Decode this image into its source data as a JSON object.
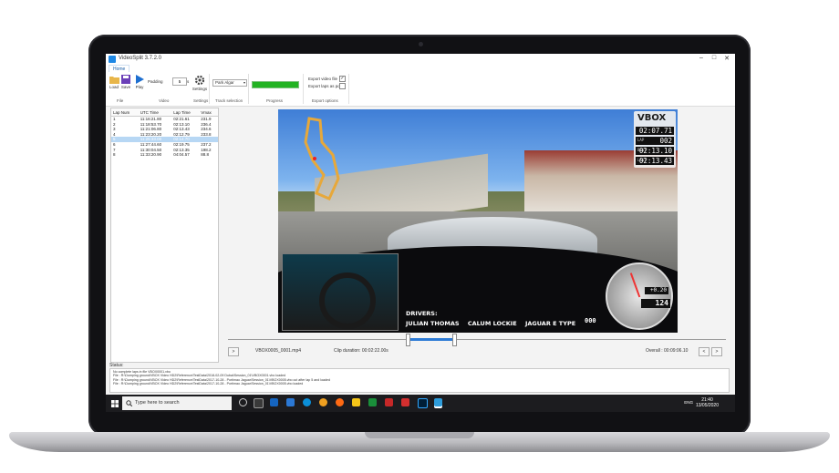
{
  "window": {
    "title": "VideoSplit 3.7.2.0"
  },
  "ribbon": {
    "tab": "Home",
    "buttons": {
      "load": "Load",
      "save": "Save",
      "play": "Play",
      "settings": "Settings"
    },
    "padding_label": "Padding",
    "padding_value": "5",
    "padding_unit": "s",
    "track": "Park Algar",
    "export": {
      "video_label": "Export video file",
      "laps_label": "Export laps as pdf",
      "video_checked": "✓",
      "laps_checked": ""
    },
    "groups": {
      "file": "File",
      "video": "Video",
      "settings": "Settings",
      "track_selection": "Track selection",
      "progress": "Progress",
      "export_options": "Export options"
    },
    "progress_fraction": 1.0
  },
  "laps": {
    "headers": [
      "Lap Num",
      "UTC Time",
      "Lap Time",
      "Vmax"
    ],
    "rows": [
      [
        "1",
        "11:16:21.80",
        "02:21.61",
        "231.9"
      ],
      [
        "2",
        "11:18:53.70",
        "02:13.10",
        "236.4"
      ],
      [
        "3",
        "11:21:06.80",
        "02:13.43",
        "234.6"
      ],
      [
        "4",
        "11:23:20.20",
        "02:12.79",
        "233.8"
      ],
      [
        "5",
        "11:25:33.00",
        "02:14.70",
        ""
      ],
      [
        "6",
        "11:27:44.60",
        "02:19.75",
        "237.2"
      ],
      [
        "7",
        "11:30:04.50",
        "02:13.35",
        "198.2"
      ],
      [
        "8",
        "11:33:20.90",
        "04:04.57",
        "88.8"
      ]
    ],
    "selected_index": 4
  },
  "overlay": {
    "logo": "VBOX",
    "time": "02:07.71",
    "lap_label": "LAP",
    "lap": "002",
    "best_label": "BEST",
    "best": "02:13.10",
    "last_label": "LAST",
    "last": "02:13.43",
    "drivers_label": "DRIVERS:",
    "drivers": [
      "JULIAN THOMAS",
      "CALUM LOCKIE",
      "JAGUAR E TYPE"
    ],
    "gear": "000",
    "gforce": "+0.20",
    "speed": "124"
  },
  "player": {
    "filename": "VBOX0005_0001.mp4",
    "clip_duration": "Clip duration: 00:02:22.00s",
    "overall": "Overall : 00:09:06.10",
    "prev_label": "<",
    "next_label": ">",
    "play_label": ">",
    "selection_start": 0.36,
    "selection_end": 0.455
  },
  "status": {
    "label": "Status:",
    "lines": [
      "No complete laps in file VBOX0001.vbo",
      "File : R:\\Dumping ground\\VBOX Video HD2\\Reference\\TestData\\2018-02-09 Dubai\\Session_01\\VBOX0001.vbo loaded",
      "File : R:\\Dumping ground\\VBOX Video HD2\\Reference\\TestData\\2017-10-28 - Portimao Jaguar\\Session_01\\VBOX0005.vbo cut after lap 5 and loaded",
      "File : R:\\Dumping ground\\VBOX Video HD2\\Reference\\TestData\\2017-10-28 - Portimao Jaguar\\Session_01\\VBOX0005.vbo loaded"
    ]
  },
  "taskbar": {
    "search_placeholder": "Type here to search",
    "lang": "ENG",
    "time": "21:40",
    "date": "13/05/2020"
  },
  "colors": {
    "accent": "#1a5fa8",
    "progress": "#22b322",
    "selection": "#b7d7f4"
  }
}
